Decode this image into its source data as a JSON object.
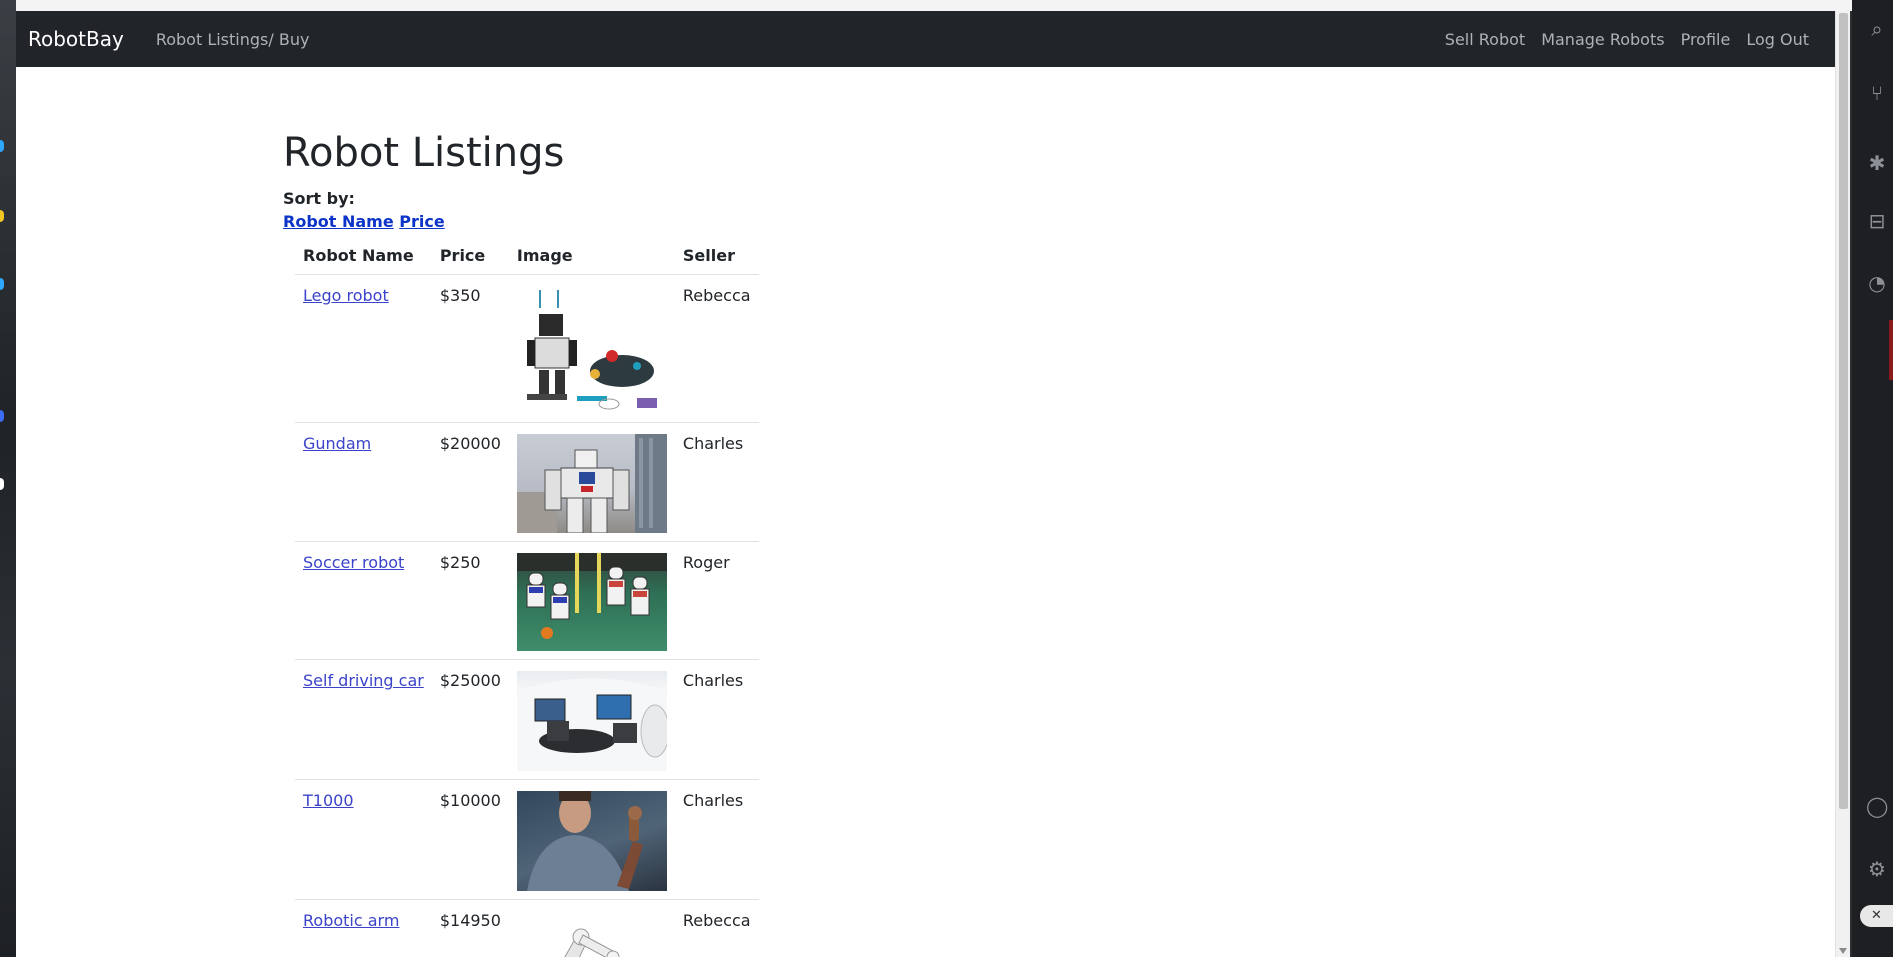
{
  "navbar": {
    "brand": "RobotBay",
    "left_links": [
      "Robot Listings/ Buy"
    ],
    "right_links": [
      "Sell Robot",
      "Manage Robots",
      "Profile",
      "Log Out"
    ]
  },
  "page": {
    "title": "Robot Listings",
    "sort_label": "Sort by:",
    "sort_options": [
      "Robot Name",
      "Price"
    ]
  },
  "table": {
    "headers": [
      "Robot Name",
      "Price",
      "Image",
      "Seller"
    ],
    "rows": [
      {
        "name": "Lego robot",
        "price": "$350",
        "image": "lego-robot-image",
        "seller": "Rebecca"
      },
      {
        "name": "Gundam",
        "price": "$20000",
        "image": "gundam-image",
        "seller": "Charles"
      },
      {
        "name": "Soccer robot",
        "price": "$250",
        "image": "soccer-robot-image",
        "seller": "Roger"
      },
      {
        "name": "Self driving car",
        "price": "$25000",
        "image": "self-driving-car-image",
        "seller": "Charles"
      },
      {
        "name": "T1000",
        "price": "$10000",
        "image": "t1000-image",
        "seller": "Charles"
      },
      {
        "name": "Robotic arm",
        "price": "$14950",
        "image": "robotic-arm-image",
        "seller": "Rebecca"
      }
    ]
  }
}
